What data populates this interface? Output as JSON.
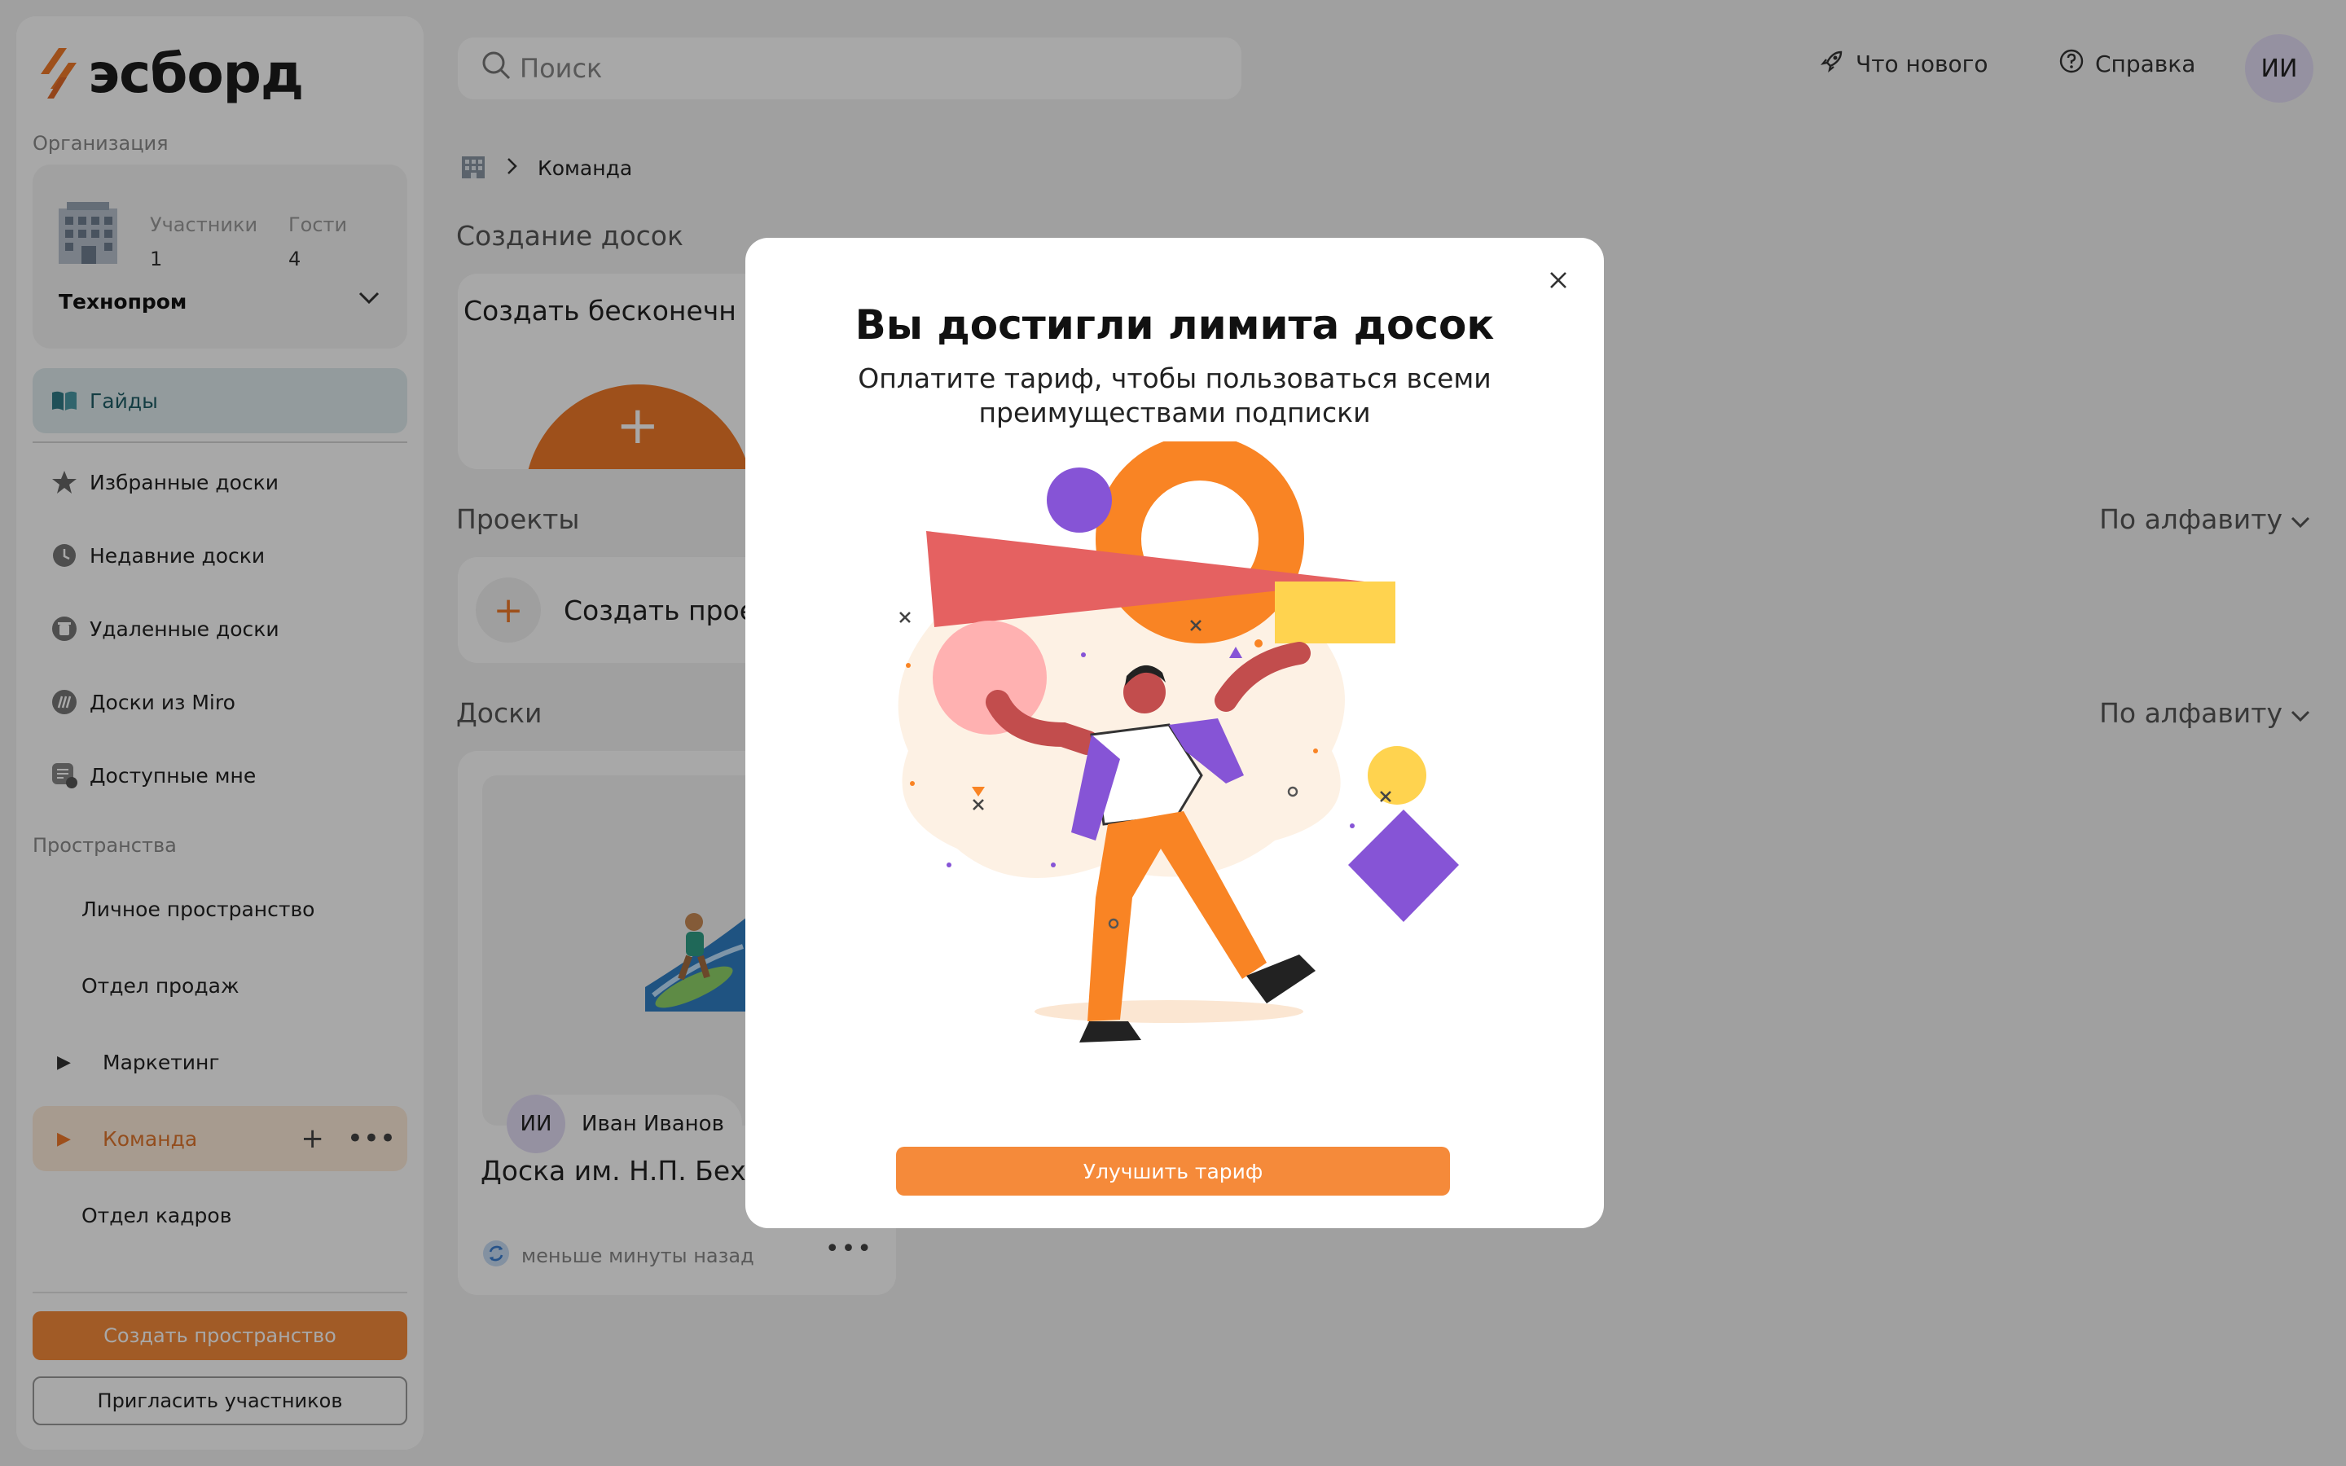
{
  "app": {
    "logo_text": "эсборд"
  },
  "sidebar": {
    "org_section_label": "Организация",
    "org": {
      "members_label": "Участники",
      "members_value": "1",
      "guests_label": "Гости",
      "guests_value": "4",
      "name": "Технопром"
    },
    "guides_label": "Гайды",
    "nav": [
      {
        "label": "Избранные доски",
        "icon": "star-icon"
      },
      {
        "label": "Недавние доски",
        "icon": "clock-icon"
      },
      {
        "label": "Удаленные доски",
        "icon": "trash-icon"
      },
      {
        "label": "Доски из Miro",
        "icon": "miro-icon"
      },
      {
        "label": "Доступные мне",
        "icon": "shared-icon"
      }
    ],
    "spaces_label": "Пространства",
    "spaces": [
      {
        "label": "Личное пространство"
      },
      {
        "label": "Отдел продаж"
      },
      {
        "label": "Маркетинг"
      },
      {
        "label": "Команда"
      },
      {
        "label": "Отдел кадров"
      }
    ],
    "create_space_label": "Создать пространство",
    "invite_label": "Пригласить участников"
  },
  "header": {
    "search_placeholder": "Поиск",
    "whats_new_label": "Что нового",
    "help_label": "Справка",
    "avatar_initials": "ИИ"
  },
  "breadcrumb": {
    "current": "Команда"
  },
  "main": {
    "create_section_title": "Создание досок",
    "create_card_label": "Создать бесконечн доску",
    "projects_title": "Проекты",
    "projects_sort": "По алфавиту",
    "create_project_label": "Создать проек",
    "boards_title": "Доски",
    "boards_sort": "По алфавиту",
    "board": {
      "owner_initials": "ИИ",
      "owner_name": "Иван Иванов",
      "title": "Доска им. Н.П. Бехте",
      "updated": "меньше минуты назад"
    }
  },
  "modal": {
    "title": "Вы достигли лимита досок",
    "subtitle": "Оплатите тариф, чтобы пользоваться всеми преимуществами подписки",
    "button_label": "Улучшить тариф"
  },
  "colors": {
    "accent": "#f58a3a",
    "guide_bg": "#dfecee",
    "space_active_bg": "#fdebd9"
  }
}
